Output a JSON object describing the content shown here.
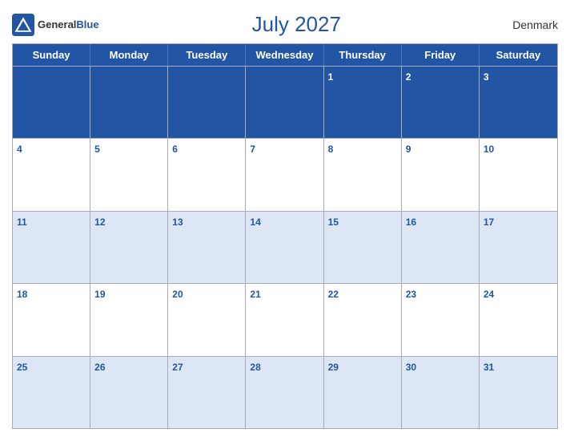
{
  "header": {
    "logo_general": "General",
    "logo_blue": "Blue",
    "title": "July 2027",
    "country": "Denmark"
  },
  "calendar": {
    "weekdays": [
      "Sunday",
      "Monday",
      "Tuesday",
      "Wednesday",
      "Thursday",
      "Friday",
      "Saturday"
    ],
    "weeks": [
      [
        {
          "day": "",
          "empty": true
        },
        {
          "day": "",
          "empty": true
        },
        {
          "day": "",
          "empty": true
        },
        {
          "day": "",
          "empty": true
        },
        {
          "day": "1"
        },
        {
          "day": "2"
        },
        {
          "day": "3"
        }
      ],
      [
        {
          "day": "4"
        },
        {
          "day": "5"
        },
        {
          "day": "6"
        },
        {
          "day": "7"
        },
        {
          "day": "8"
        },
        {
          "day": "9"
        },
        {
          "day": "10"
        }
      ],
      [
        {
          "day": "11"
        },
        {
          "day": "12"
        },
        {
          "day": "13"
        },
        {
          "day": "14"
        },
        {
          "day": "15"
        },
        {
          "day": "16"
        },
        {
          "day": "17"
        }
      ],
      [
        {
          "day": "18"
        },
        {
          "day": "19"
        },
        {
          "day": "20"
        },
        {
          "day": "21"
        },
        {
          "day": "22"
        },
        {
          "day": "23"
        },
        {
          "day": "24"
        }
      ],
      [
        {
          "day": "25"
        },
        {
          "day": "26"
        },
        {
          "day": "27"
        },
        {
          "day": "28"
        },
        {
          "day": "29"
        },
        {
          "day": "30"
        },
        {
          "day": "31"
        }
      ]
    ]
  }
}
